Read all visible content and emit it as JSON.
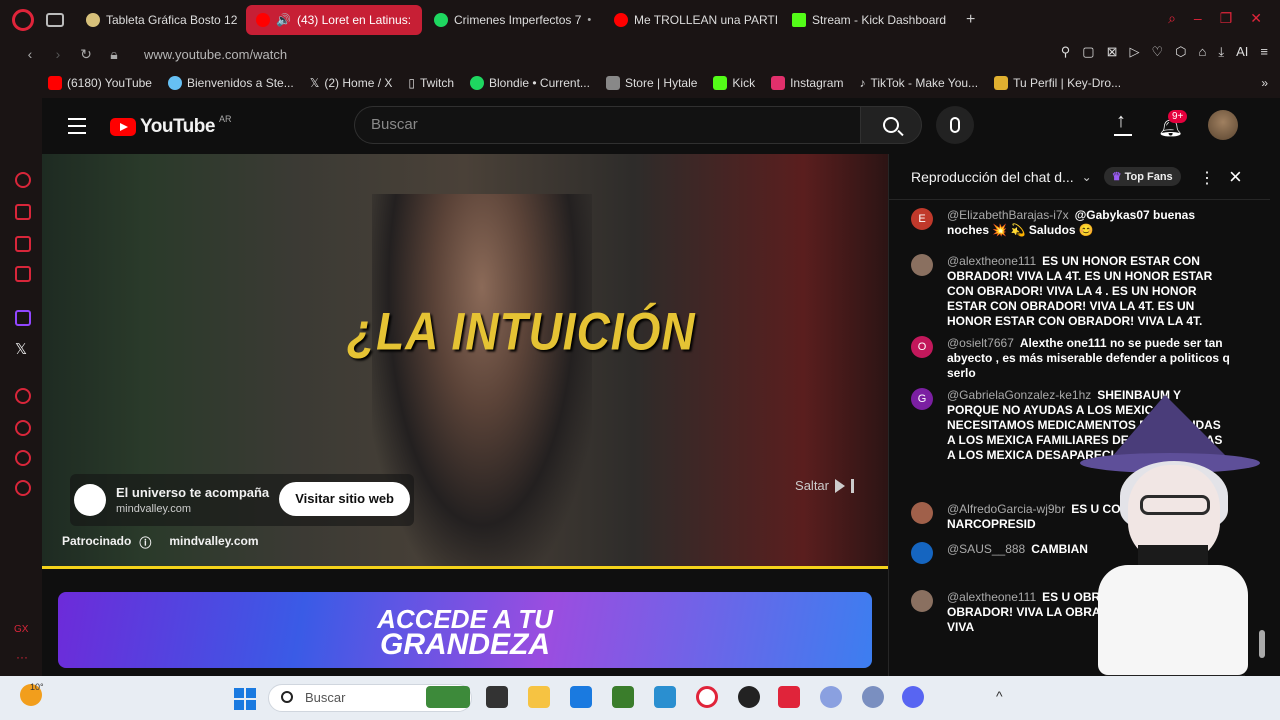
{
  "browser": {
    "tabs": [
      {
        "label": "Tableta Gráfica Bosto 12",
        "active": false,
        "color": "#d7c07a"
      },
      {
        "label": "(43) Loret en Latinus:",
        "active": true,
        "color": "#ff0000"
      },
      {
        "label": "Crimenes Imperfectos 7",
        "active": false,
        "color": "#1ed760"
      },
      {
        "label": "Me TROLLEAN una PARTI",
        "active": false,
        "color": "#ff0000"
      },
      {
        "label": "Stream - Kick Dashboard",
        "active": false,
        "color": "#53fc18"
      }
    ],
    "url": "www.youtube.com/watch",
    "bookmarks": [
      {
        "label": "(6180) YouTube",
        "color": "#ff0000"
      },
      {
        "label": "Bienvenidos a Ste...",
        "color": "#66c0f4"
      },
      {
        "label": "(2) Home / X",
        "color": "#ffffff"
      },
      {
        "label": "Twitch",
        "color": "#9146ff"
      },
      {
        "label": "Blondie • Current...",
        "color": "#1ed760"
      },
      {
        "label": "Store | Hytale",
        "color": "#888888"
      },
      {
        "label": "Kick",
        "color": "#53fc18"
      },
      {
        "label": "Instagram",
        "color": "#e1306c"
      },
      {
        "label": "TikTok - Make You...",
        "color": "#ffffff"
      },
      {
        "label": "Tu Perfil | Key-Dro...",
        "color": "#e0b030"
      }
    ],
    "ai_label": "AI"
  },
  "youtube": {
    "logo_text": "YouTube",
    "region": "AR",
    "search_placeholder": "Buscar",
    "notifications_badge": "9+"
  },
  "video": {
    "caption": "¿LA INTUICIÓN",
    "ad_title": "El universo te acompaña",
    "ad_domain": "mindvalley.com",
    "ad_button": "Visitar sitio web",
    "sponsored_label": "Patrocinado",
    "sponsored_domain": "mindvalley.com",
    "skip_label": "Saltar"
  },
  "banner": {
    "line1": "ACCEDE A TU",
    "line2": "GRANDEZA"
  },
  "chat": {
    "title": "Reproducción del chat d...",
    "top_fans": "Top Fans",
    "messages": [
      {
        "initial": "E",
        "color": "#c0392b",
        "author": "@ElizabethBarajas-i7x",
        "text": "@Gabykas07 buenas noches 💥 💫 Saludos 😊"
      },
      {
        "initial": "",
        "color": "#8a7060",
        "author": "@alextheone111",
        "text": "ES UN HONOR ESTAR CON OBRADOR! VIVA LA 4T. ES UN HONOR ESTAR CON OBRADOR! VIVA LA 4 . ES UN HONOR ESTAR CON OBRADOR! VIVA LA 4T. ES UN HONOR ESTAR CON OBRADOR! VIVA LA 4T."
      },
      {
        "initial": "O",
        "color": "#c2185b",
        "author": "@osielt7667",
        "text": "Alexthe one111 no se puede ser tan abyecto , es más miserable defender a politicos q serlo"
      },
      {
        "initial": "G",
        "color": "#7b1fa2",
        "author": "@GabrielaGonzalez-ke1hz",
        "text": "SHEINBAUM Y PORQUE NO AYUDAS A LOS MEXICA NECESITAMOS MEDICAMENTOS P NO AYUDAS A LOS MEXICA FAMILIARES DESAPAR AYUDAS A LOS MEXICA DESAPARECI"
      },
      {
        "initial": "",
        "color": "#a0604a",
        "author": "@AlfredoGarcia-wj9br",
        "text": "ES U CON KKDOR NARCOPRESID"
      },
      {
        "initial": "",
        "color": "#1565c0",
        "author": "@SAUS__888",
        "text": "CAMBIAN"
      },
      {
        "initial": "",
        "color": "#8a7060",
        "author": "@alextheone111",
        "text": "ES U OBRADOR! VIVA LA 4 OBRADOR! VIVA LA OBRADOR! VIVA OBRADOR! VIVA"
      }
    ]
  },
  "taskbar": {
    "search_placeholder": "Buscar",
    "weather": "10°"
  }
}
